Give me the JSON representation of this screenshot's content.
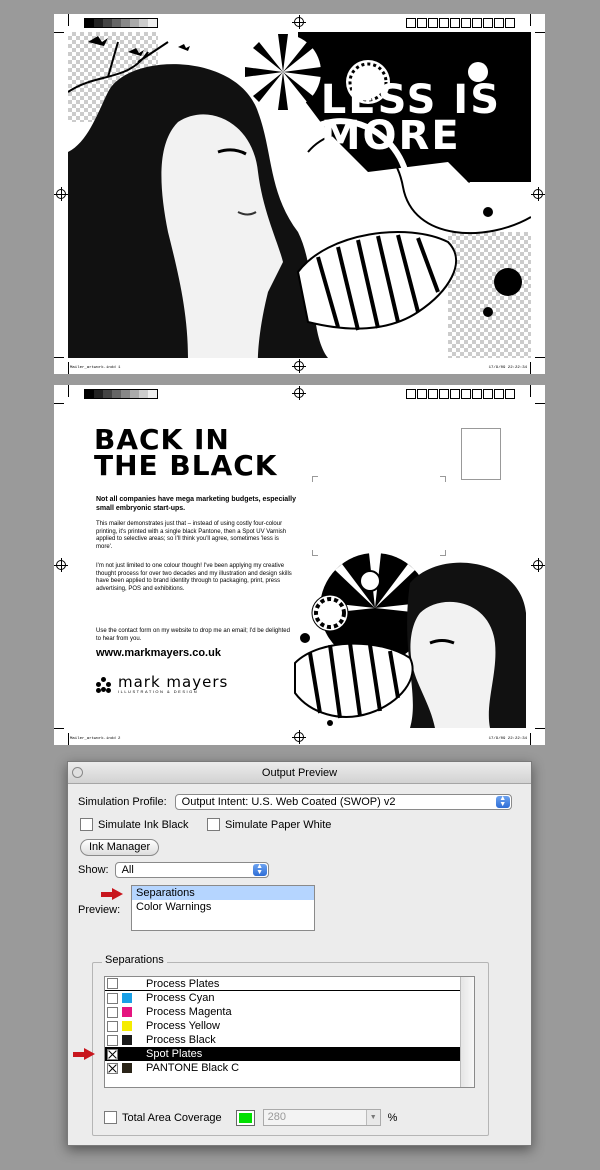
{
  "artwork": {
    "page1": {
      "slug_left": "Mailer_artwork.indd   1",
      "slug_right": "17/9/09   22:22:34",
      "headline": [
        "LESS IS",
        "MORE"
      ]
    },
    "page2": {
      "slug_left": "Mailer_artwork.indd   2",
      "slug_right": "17/9/09   22:22:34",
      "title": [
        "BACK IN",
        "THE BLACK"
      ],
      "intro_bold": "Not all companies have mega marketing budgets, especially small embryonic start-ups.",
      "para1": "This mailer demonstrates just that – instead of using costly four-colour printing, it's printed with a single black Pantone, then a Spot UV Varnish applied to selective areas; so I'll think you'll agree, sometimes 'less is more'.",
      "para2": "I'm not just limited to one colour though! I've been applying my creative thought process for over two decades and my illustration and design skills have been applied to brand identity through to packaging, print, press advertising, POS and exhibitions.",
      "para3": "Use the contact form on my website to drop me an email; I'd be delighted to hear from you.",
      "url": "www.markmayers.co.uk",
      "logo_name": "mark mayers",
      "logo_sub": "ILLUSTRATION & DESIGN"
    }
  },
  "panel": {
    "title": "Output Preview",
    "simulation_profile_label": "Simulation Profile:",
    "simulation_profile_value": "Output Intent: U.S. Web Coated (SWOP) v2",
    "simulate_ink_black": "Simulate Ink Black",
    "simulate_paper_white": "Simulate Paper White",
    "ink_manager": "Ink Manager",
    "show_label": "Show:",
    "show_value": "All",
    "preview_label": "Preview:",
    "preview_options": [
      "Separations",
      "Color Warnings"
    ],
    "preview_selected": "Separations",
    "separations_legend": "Separations",
    "separations": [
      {
        "label": "Process Plates",
        "checked": false,
        "swatch": null,
        "header": true
      },
      {
        "label": "Process Cyan",
        "checked": false,
        "swatch": "#1aa0e6"
      },
      {
        "label": "Process Magenta",
        "checked": false,
        "swatch": "#e5147f"
      },
      {
        "label": "Process Yellow",
        "checked": false,
        "swatch": "#f5ec00"
      },
      {
        "label": "Process Black",
        "checked": false,
        "swatch": "#1a1a1a"
      },
      {
        "label": "Spot Plates",
        "checked": true,
        "swatch": null,
        "selected": true
      },
      {
        "label": "PANTONE Black C",
        "checked": true,
        "swatch": "#2a2418"
      }
    ],
    "total_area_coverage_label": "Total Area Coverage",
    "total_area_coverage_value": "280",
    "percent_symbol": "%",
    "coverage_color": "#00e000"
  }
}
